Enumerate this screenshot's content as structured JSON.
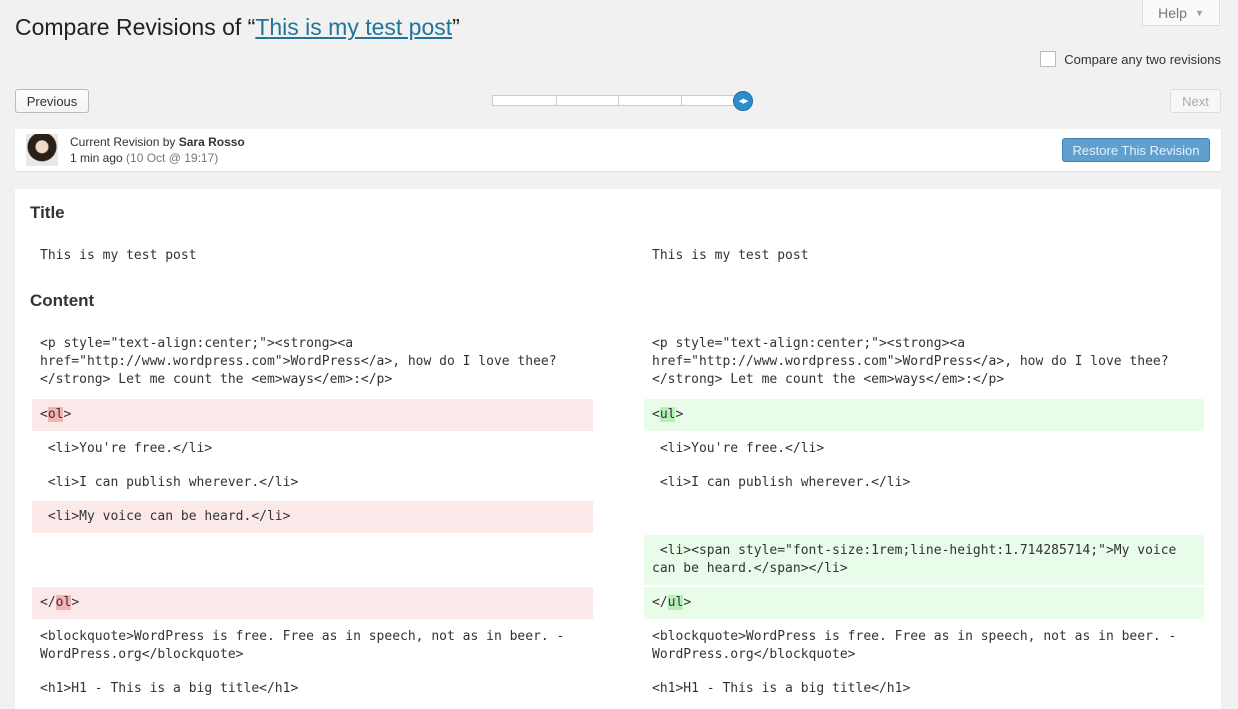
{
  "help": {
    "label": "Help",
    "arrow": "▼"
  },
  "title": {
    "prefix": "Compare Revisions of “",
    "post_link": "This is my test post",
    "suffix": "”"
  },
  "compare_two": {
    "label": "Compare any two revisions",
    "checked": false
  },
  "nav": {
    "previous": "Previous",
    "next": "Next",
    "slider_position_fraction": 1.0
  },
  "revision": {
    "label": "Current Revision by ",
    "author": "Sara Rosso",
    "ago": "1 min ago",
    "date": " (10 Oct @ 19:17)",
    "restore_button": "Restore This Revision"
  },
  "diff": {
    "title_heading": "Title",
    "content_heading": "Content",
    "title_left": "This is my test post",
    "title_right": "This is my test post",
    "para_left": "<p style=\"text-align:center;\"><strong><a href=\"http://www.wordpress.com\">WordPress</a>, how do I love thee?</strong> Let me count the <em>ways</em>:</p>",
    "para_right": "<p style=\"text-align:center;\"><strong><a href=\"http://www.wordpress.com\">WordPress</a>, how do I love thee?</strong> Let me count the <em>ways</em>:</p>",
    "ol_open": {
      "before": "<",
      "hl": "ol",
      "after": ">"
    },
    "ul_open": {
      "before": "<",
      "hl": "ul",
      "after": ">"
    },
    "li1": " <li>You're free.</li>",
    "li2": " <li>I can publish wherever.</li>",
    "li3_left": " <li>My voice can be heard.</li>",
    "li3_right": " <li><span style=\"font-size:1rem;line-height:1.714285714;\">My voice can be heard.</span></li>",
    "ol_close": {
      "before": "</",
      "hl": "ol",
      "after": ">"
    },
    "ul_close": {
      "before": "</",
      "hl": "ul",
      "after": ">"
    },
    "blockquote": "<blockquote>WordPress is free. Free as in speech, not as in beer. -WordPress.org</blockquote>",
    "cut_line": "<h1>H1 - This is a big title</h1>"
  }
}
